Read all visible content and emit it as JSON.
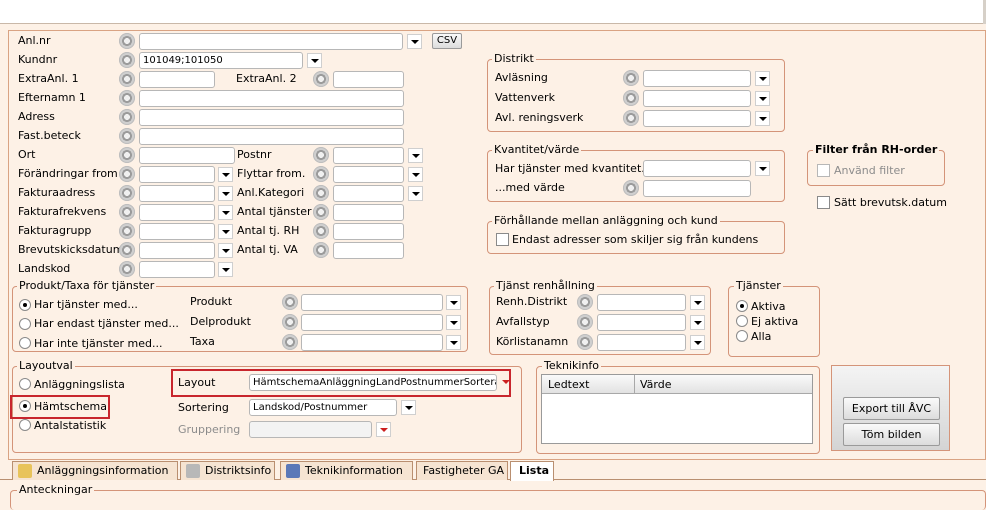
{
  "main_form": {
    "anl_nr_label": "Anl.nr",
    "anl_nr_value": "",
    "csv_label": "CSV",
    "kundnr_label": "Kundnr",
    "kundnr_value": "101049;101050",
    "extra1_label": "ExtraAnl. 1",
    "extra2_label": "ExtraAnl. 2",
    "efternamn_label": "Efternamn 1",
    "adress_label": "Adress",
    "fastbeteck_label": "Fast.beteck",
    "ort_label": "Ort",
    "postnr_label": "Postnr",
    "forandringar_label": "Förändringar from",
    "flyttar_label": "Flyttar from.",
    "fakturaadress_label": "Fakturaadress",
    "anlkategori_label": "Anl.Kategori",
    "fakturafrekvens_label": "Fakturafrekvens",
    "antal_tjanster_label": "Antal tjänster",
    "fakturagrupp_label": "Fakturagrupp",
    "antal_rh_label": "Antal tj. RH",
    "brevutskick_label": "Brevutskicksdatum",
    "antal_va_label": "Antal tj. VA",
    "landskod_label": "Landskod"
  },
  "distrikt": {
    "title": "Distrikt",
    "avlasning_label": "Avläsning",
    "vattenverk_label": "Vattenverk",
    "avlreningsverk_label": "Avl. reningsverk"
  },
  "kvantitet": {
    "title": "Kvantitet/värde",
    "har_tjanster_label": "Har tjänster med kvantitet...",
    "med_varde_label": "...med värde"
  },
  "forhallande": {
    "title": "Förhållande mellan anläggning och kund",
    "endast_label": "Endast adresser som skiljer sig från kundens"
  },
  "filter_rh": {
    "title": "Filter från RH-order",
    "anvand_label": "Använd filter"
  },
  "satt_brevutsk_label": "Sätt brevutsk.datum",
  "produkt": {
    "title": "Produkt/Taxa för tjänster",
    "radios": [
      "Har tjänster med...",
      "Har endast tjänster med...",
      "Har inte tjänster med..."
    ],
    "produkt_label": "Produkt",
    "delprodukt_label": "Delprodukt",
    "taxa_label": "Taxa"
  },
  "tjanst_renh": {
    "title": "Tjänst renhållning",
    "distrikt_label": "Renh.Distrikt",
    "avfallstyp_label": "Avfallstyp",
    "korlistanamn_label": "Körlistanamn"
  },
  "tjanster": {
    "title": "Tjänster",
    "radios": [
      "Aktiva",
      "Ej aktiva",
      "Alla"
    ]
  },
  "layoutval": {
    "title": "Layoutval",
    "radios": [
      "Anläggningslista",
      "Hämtschema",
      "Antalstatistik"
    ],
    "layout_label": "Layout",
    "layout_value": "HämtschemaAnläggningLandPostnummerSorterad",
    "sortering_label": "Sortering",
    "sortering_value": "Landskod/Postnummer",
    "gruppering_label": "Gruppering",
    "gruppering_value": ""
  },
  "teknikinfo": {
    "title": "Teknikinfo",
    "columns": [
      "Ledtext",
      "Värde"
    ]
  },
  "actions": {
    "export_label": "Export till ÅVC",
    "tom_label": "Töm bilden"
  },
  "tabs": [
    "Anläggningsinformation",
    "Distriktsinfo",
    "Teknikinformation",
    "Fastigheter GA",
    "Lista"
  ],
  "anteckningar_label": "Anteckningar",
  "colors": {
    "border": "#d49479",
    "highlight": "#c8262d",
    "background": "#fdf1e6"
  }
}
